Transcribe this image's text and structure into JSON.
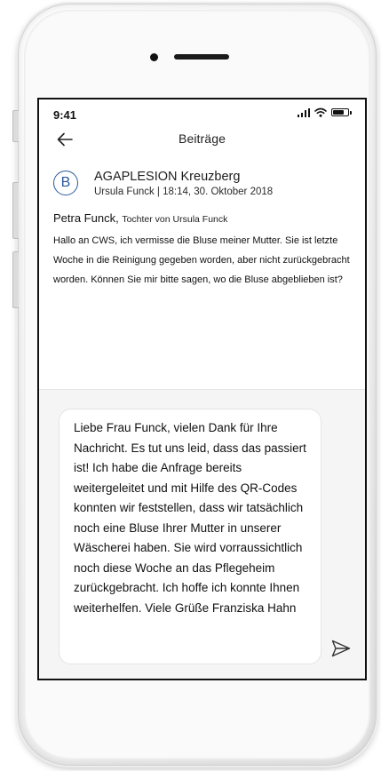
{
  "status_bar": {
    "time": "9:41",
    "icons": [
      "signal-icon",
      "wifi-icon",
      "battery-icon"
    ],
    "battery_level": 0.8
  },
  "nav": {
    "back_icon": "arrow-left-icon",
    "title": "Beiträge"
  },
  "post": {
    "avatar_letter": "B",
    "organization": "AGAPLESION Kreuzberg",
    "meta": "Ursula Funck | 18:14, 30. Oktober 2018",
    "author_name": "Petra Funck,",
    "author_role": "Tochter von Ursula Funck",
    "message": "Hallo an CWS, ich vermisse die Bluse meiner Mutter. Sie ist letzte Woche in die Reinigung gegeben worden, aber nicht zurückgebracht worden. Können Sie mir bitte sagen, wo die Bluse abgeblieben ist?"
  },
  "reply": {
    "text": "Liebe Frau Funck, vielen Dank für Ihre Nachricht. Es tut uns leid, dass das passiert ist! Ich habe die Anfrage bereits weitergeleitet und mit Hilfe des QR-Codes konnten wir feststellen, dass wir tatsächlich noch eine Bluse Ihrer Mutter in unserer Wäscherei haben. Sie wird vorraussichtlich noch diese Woche an das Pflegeheim zurückgebracht. Ich hoffe ich konnte Ihnen weiterhelfen. Viele Grüße Franziska Hahn",
    "send_icon": "send-icon"
  },
  "colors": {
    "accent": "#2a5a9c",
    "reply_background": "#f5f5f5",
    "bubble_background": "#ffffff"
  }
}
